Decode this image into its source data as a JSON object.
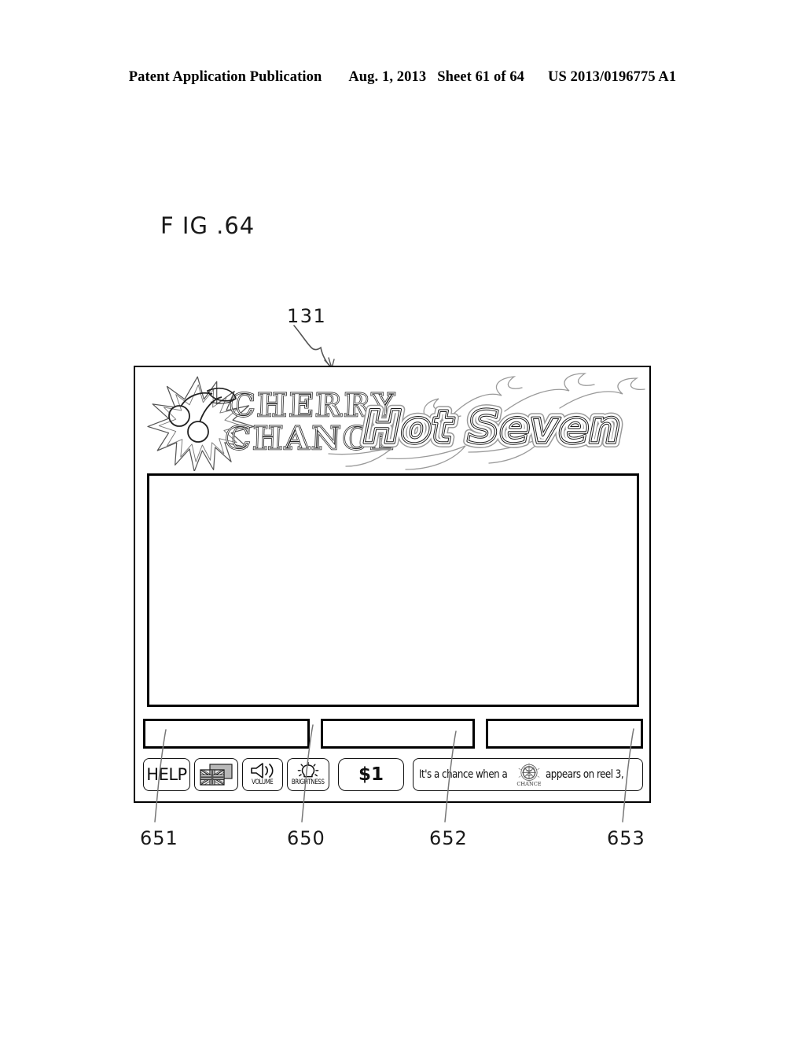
{
  "header": {
    "publication": "Patent Application Publication",
    "date": "Aug. 1, 2013",
    "sheet": "Sheet 61 of 64",
    "patent_number": "US 2013/0196775 A1"
  },
  "figure": {
    "label": "F IG .64",
    "screen_callout": "131"
  },
  "screen": {
    "logo": {
      "primary_line1": "CHERRY",
      "primary_line2": "CHANCE",
      "secondary": "Hot Seven",
      "starburst_icon": "starburst-icon",
      "cherries_icon": "cherries-icon",
      "flame_icon": "flame-icon"
    },
    "game_display": {
      "content": ""
    },
    "info_panels": [
      {
        "name": "info-panel-left",
        "value": ""
      },
      {
        "name": "info-panel-mid",
        "value": ""
      },
      {
        "name": "info-panel-right",
        "value": ""
      }
    ],
    "controls": {
      "help_label": "HELP",
      "language_icon": "flag-icon",
      "volume_label": "VOLUME",
      "volume_icon": "speaker-icon",
      "brightness_label": "BRIGHTNESS",
      "brightness_icon": "sun-icon",
      "bet_label": "$1"
    },
    "message_bar": {
      "text_before": "It's a chance when a",
      "symbol_icon": "chance-emblem-icon",
      "symbol_label": "CHANCE",
      "text_after": "appears on reel 3,"
    }
  },
  "reference_numbers": {
    "help_button": "651",
    "control_bar": "650",
    "bet_button": "652",
    "message_bar": "653"
  },
  "colors": {
    "ink": "#000000",
    "paper": "#ffffff",
    "label_gray": "#1a1a1a"
  }
}
